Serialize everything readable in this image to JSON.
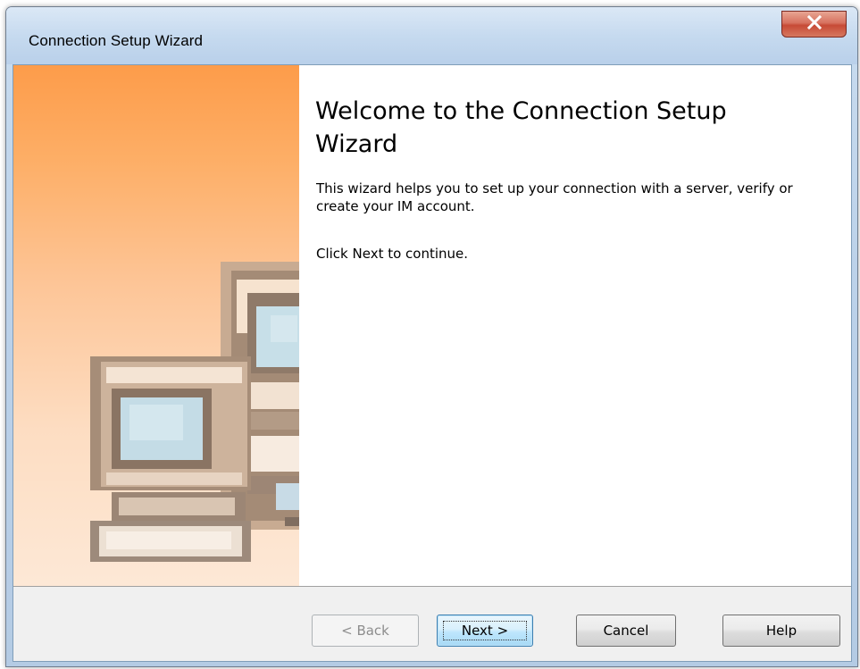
{
  "window": {
    "title": "Connection Setup Wizard",
    "close_icon": "close-icon"
  },
  "side_panel": {
    "illustration_icon": "computers-icon"
  },
  "main": {
    "heading": "Welcome to the Connection Setup Wizard",
    "description": "This wizard helps you to set up your connection with a server, verify or create your IM account.",
    "hint": "Click Next to continue."
  },
  "buttons": {
    "back_label": "< Back",
    "back_enabled": false,
    "next_label": "Next >",
    "cancel_label": "Cancel",
    "help_label": "Help"
  },
  "colors": {
    "side_panel_top": "#fd9c4a",
    "side_panel_bottom": "#fde8d6",
    "close_button": "#c74a36",
    "default_button_border": "#3c7fb1"
  }
}
